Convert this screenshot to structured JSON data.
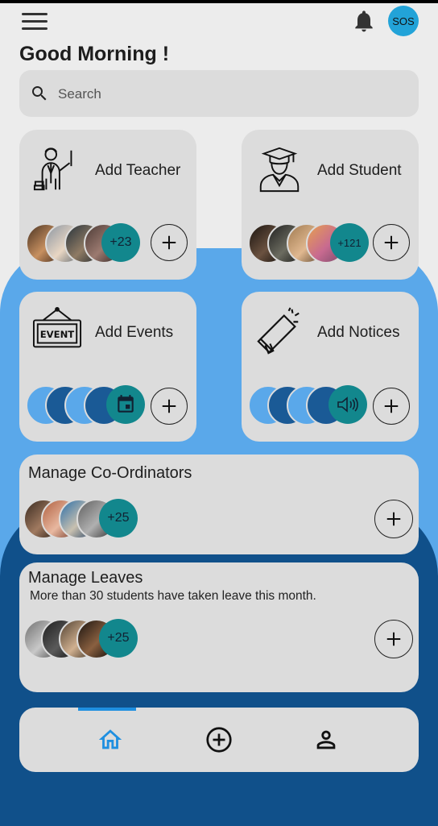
{
  "header": {
    "menu_icon": "hamburger-menu-icon",
    "notification_icon": "bell-icon",
    "sos_label": "SOS",
    "greeting": "Good Morning !"
  },
  "search": {
    "placeholder": "Search",
    "icon": "search-icon"
  },
  "cards": [
    {
      "title": "Add Teacher",
      "icon": "teacher-icon",
      "count": "+23",
      "action_icon": "plus-icon"
    },
    {
      "title": "Add Student",
      "icon": "student-graduate-icon",
      "count": "+121",
      "action_icon": "plus-icon"
    },
    {
      "title": "Add Events",
      "icon": "event-board-icon",
      "count_icon": "calendar-event-icon",
      "action_icon": "plus-icon"
    },
    {
      "title": "Add Notices",
      "icon": "megaphone-icon",
      "count_icon": "speaker-volume-icon",
      "action_icon": "plus-icon"
    }
  ],
  "coordinators": {
    "title": "Manage Co-Ordinators",
    "count": "+25"
  },
  "leaves": {
    "title": "Manage Leaves",
    "subtitle": "More than 30 students have taken leave this month.",
    "count": "+25"
  },
  "bottom_nav": {
    "items": [
      {
        "icon": "home-icon",
        "active": true
      },
      {
        "icon": "add-circle-icon",
        "active": false
      },
      {
        "icon": "profile-icon",
        "active": false
      }
    ]
  },
  "colors": {
    "accent_light": "#5aa8ea",
    "accent_dark": "#10508a",
    "count_badge": "#12878d",
    "sos": "#22a3d8",
    "active_nav": "#1f8fe0"
  }
}
